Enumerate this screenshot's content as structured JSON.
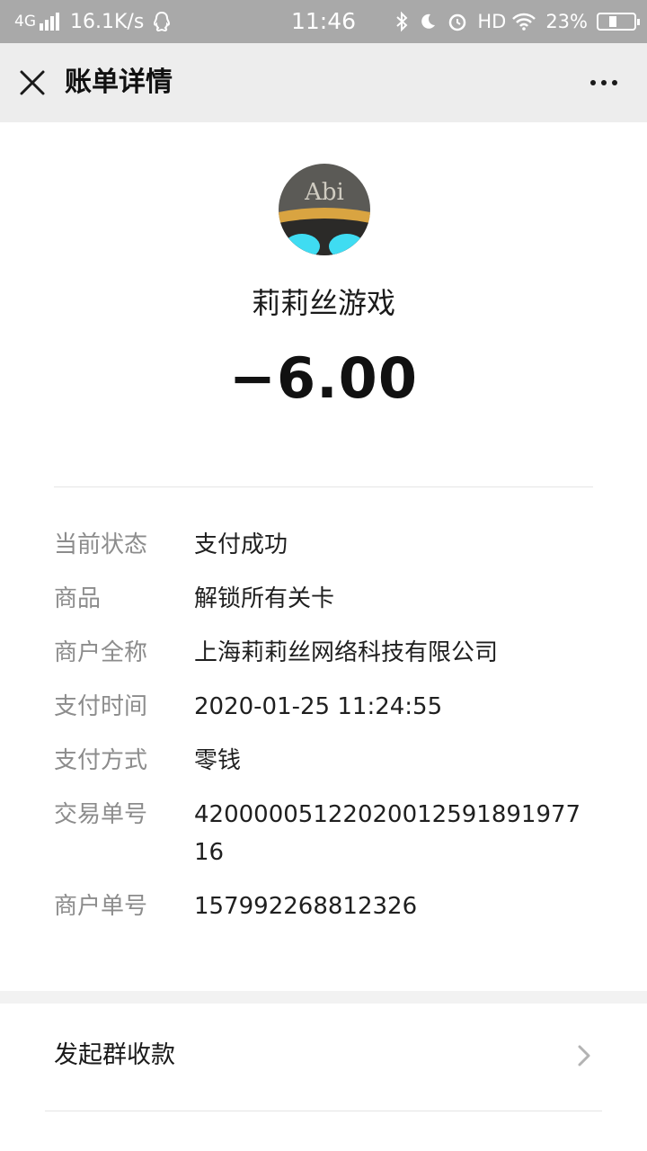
{
  "status_bar": {
    "network": "4G",
    "speed": "16.1K/s",
    "time": "11:46",
    "hd": "HD",
    "battery": "23%",
    "battery_level": 0.23
  },
  "titlebar": {
    "title": "账单详情"
  },
  "merchant": {
    "name": "莉莉丝游戏",
    "amount": "−6.00",
    "avatar_text": "Abi"
  },
  "details": [
    {
      "label": "当前状态",
      "value": "支付成功"
    },
    {
      "label": "商品",
      "value": "解锁所有关卡"
    },
    {
      "label": "商户全称",
      "value": "上海莉莉丝网络科技有限公司"
    },
    {
      "label": "支付时间",
      "value": "2020-01-25 11:24:55"
    },
    {
      "label": "支付方式",
      "value": "零钱"
    },
    {
      "label": "交易单号",
      "value": "4200000512202001259189197716"
    },
    {
      "label": "商户单号",
      "value": "157992268812326"
    }
  ],
  "actions": {
    "group_collect": "发起群收款"
  },
  "colors": {
    "status_bar_bg": "#a9a9a9",
    "titlebar_bg": "#ededed",
    "label_gray": "#8c8c8c"
  }
}
